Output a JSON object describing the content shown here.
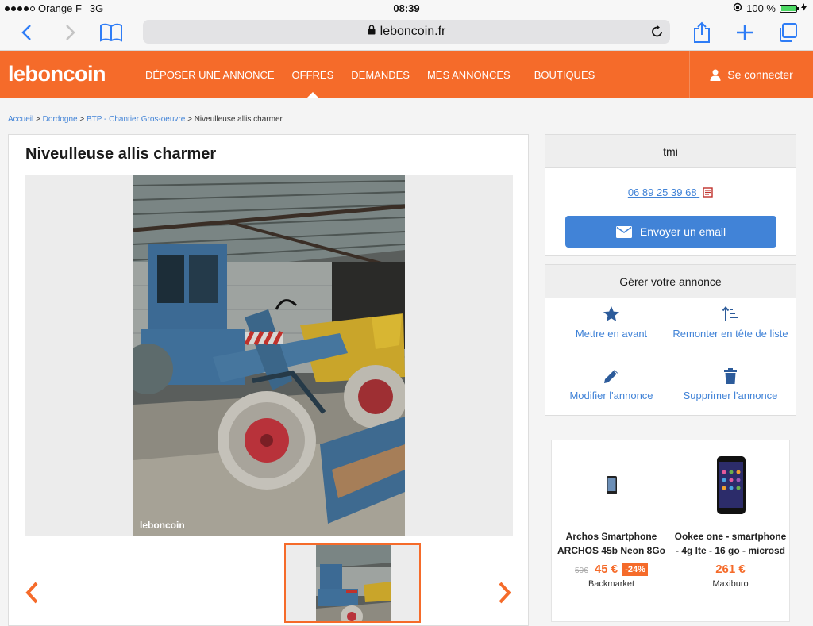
{
  "status_bar": {
    "carrier": "Orange F",
    "network": "3G",
    "time": "08:39",
    "battery": "100 %"
  },
  "browser": {
    "url": "leboncoin.fr"
  },
  "header": {
    "logo": "leboncoin",
    "nav": [
      {
        "label": "DÉPOSER UNE ANNONCE",
        "active": false
      },
      {
        "label": "OFFRES",
        "active": true
      },
      {
        "label": "DEMANDES",
        "active": false
      },
      {
        "label": "MES ANNONCES",
        "active": false
      },
      {
        "label": "BOUTIQUES",
        "active": false
      }
    ],
    "login": "Se connecter"
  },
  "breadcrumb": {
    "items": [
      "Accueil",
      "Dordogne",
      "BTP - Chantier Gros-oeuvre"
    ],
    "current": "Niveulleuse allis charmer",
    "separator": ">"
  },
  "ad": {
    "title": "Niveulleuse allis charmer",
    "watermark": "leboncoin"
  },
  "contact": {
    "seller": "tmi",
    "phone": "06 89 25 39 68",
    "email_button": "Envoyer un email"
  },
  "manage": {
    "title": "Gérer votre annonce",
    "actions": [
      {
        "label": "Mettre en avant",
        "icon": "star-icon"
      },
      {
        "label": "Remonter en tête de liste",
        "icon": "sort-up-icon"
      },
      {
        "label": "Modifier l'annonce",
        "icon": "pencil-icon"
      },
      {
        "label": "Supprimer l'annonce",
        "icon": "trash-icon"
      }
    ]
  },
  "promo": {
    "products": [
      {
        "name_line1": "Archos Smartphone",
        "name_line2": "ARCHOS 45b Neon 8Go",
        "old_price": "59€",
        "price": "45 €",
        "discount": "-24%",
        "shop": "Backmarket"
      },
      {
        "name_line1": "Ookee one - smartphone",
        "name_line2": "- 4g lte - 16 go - microsd",
        "old_price": "",
        "price": "261 €",
        "discount": "",
        "shop": "Maxiburo"
      }
    ]
  },
  "colors": {
    "brand": "#f56b2a",
    "link": "#4183d7"
  }
}
